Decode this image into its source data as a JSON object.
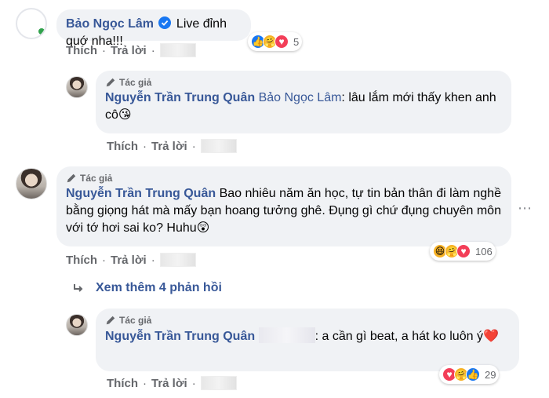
{
  "comments": [
    {
      "author": "Bảo Ngọc Lâm",
      "text": "Live đỉnh quớ nha!!!",
      "reaction_count": "5",
      "reactions": [
        "like-icon",
        "care-icon",
        "love-icon"
      ]
    },
    {
      "author_tag": "Tác giả",
      "author": "Nguyễn Trần Trung Quân",
      "mention": "Bảo Ngọc Lâm",
      "text": ": lâu lắm mới thấy khen anh cô😘"
    },
    {
      "author_tag": "Tác giả",
      "author": "Nguyễn Trần Trung Quân",
      "text": "Bao nhiêu năm ăn học, tự tin bản thân đi làm nghề bằng giọng hát mà mấy bạn hoang tưởng ghê. Đụng gì chứ đụng chuyên môn với tớ hơi sai ko? Huhu😲",
      "reaction_count": "106",
      "reactions": [
        "haha-icon",
        "care-icon",
        "love-icon"
      ]
    },
    {
      "author_tag": "Tác giả",
      "author": "Nguyễn Trần Trung Quân",
      "text": ": a cần gì beat, a hát ko luôn ý❤️",
      "reaction_count": "29",
      "reactions": [
        "love-icon",
        "care-icon",
        "like-icon"
      ]
    }
  ],
  "actions": {
    "like": "Thích",
    "reply": "Trả lời",
    "separator": "·"
  },
  "view_more": "Xem thêm 4 phản hồi",
  "colors": {
    "link": "#385898",
    "bubble": "#f0f2f5",
    "meta": "#65676b",
    "like": "#1877f2",
    "love": "#f33e58",
    "care": "#f7b125"
  }
}
